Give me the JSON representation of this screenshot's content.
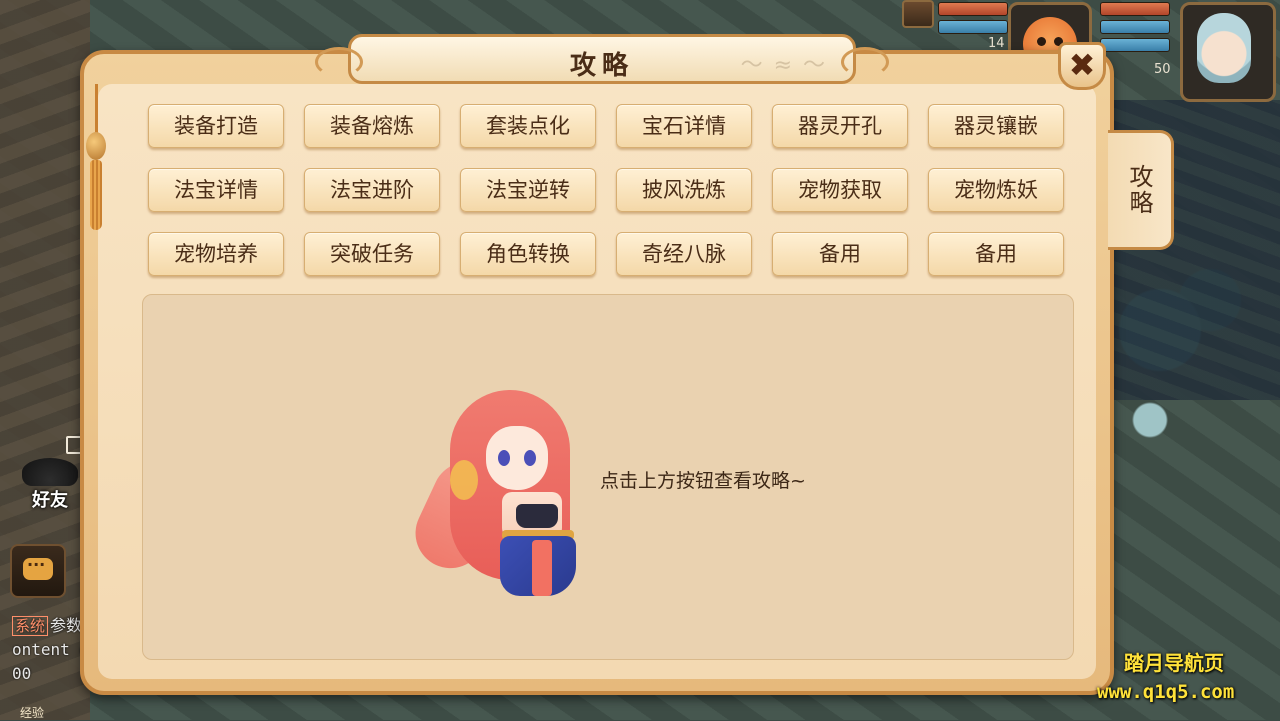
{
  "dialog": {
    "title": "攻略",
    "close_label": "✖",
    "side_tab": "攻略"
  },
  "guide_buttons": [
    "装备打造",
    "装备熔炼",
    "套装点化",
    "宝石详情",
    "器灵开孔",
    "器灵镶嵌",
    "法宝详情",
    "法宝进阶",
    "法宝逆转",
    "披风洗炼",
    "宠物获取",
    "宠物炼妖",
    "宠物培养",
    "突破任务",
    "角色转换",
    "奇经八脉",
    "备用",
    "备用"
  ],
  "content": {
    "hint": "点击上方按钮查看攻略~"
  },
  "hud": {
    "pet_level": "14",
    "player_level": "50"
  },
  "left_hud": {
    "friend_label": "好友",
    "chat_tag": "系统",
    "chat_lines": [
      "参数",
      "ontent du",
      "00"
    ],
    "exp_label": "经验"
  },
  "watermark": {
    "name": "踏月导航页",
    "url": "www.q1q5.com"
  },
  "colors": {
    "dialog_border": "#c88a44",
    "button_text": "#4a2d17",
    "watermark": "#ffe23a"
  }
}
